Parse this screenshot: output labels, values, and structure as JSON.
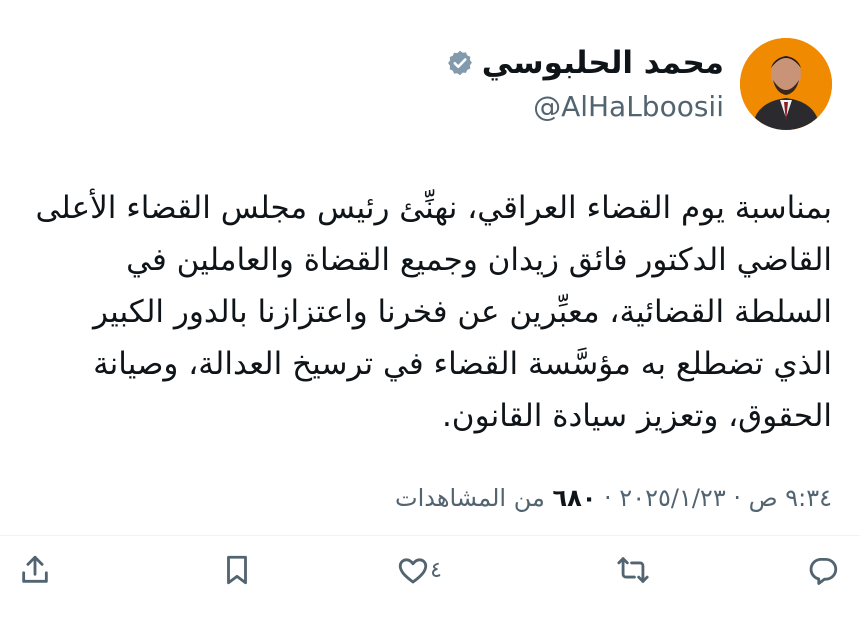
{
  "author": {
    "display_name": "محمد الحلبوسي",
    "handle": "@AlHaLboosii",
    "verified_icon": "verified-badge-icon"
  },
  "tweet": {
    "text": "بمناسبة يوم القضاء العراقي، نهنِّئ رئيس مجلس القضاء الأعلى\nالقاضي الدكتور فائق زيدان وجميع القضاة والعاملين في\nالسلطة القضائية، معبِّرين عن فخرنا واعتزازنا بالدور الكبير\nالذي تضطلع به مؤسَّسة القضاء في ترسيخ العدالة، وصيانة\nالحقوق، وتعزيز سيادة القانون."
  },
  "meta": {
    "datetime": "٩:٣٤ ص · ٢٠٢٥/١/٢٣ · ",
    "views_count": "٦٨٠",
    "views_label": " من المشاهدات"
  },
  "actions": {
    "reply_icon": "reply-icon",
    "retweet_icon": "retweet-icon",
    "like_icon": "like-icon",
    "like_count": "٤",
    "bookmark_icon": "bookmark-icon",
    "share_icon": "share-icon"
  },
  "colors": {
    "text": "#0f1419",
    "secondary": "#536471",
    "avatar_bg": "#f08a00",
    "divider": "#eff3f4"
  }
}
